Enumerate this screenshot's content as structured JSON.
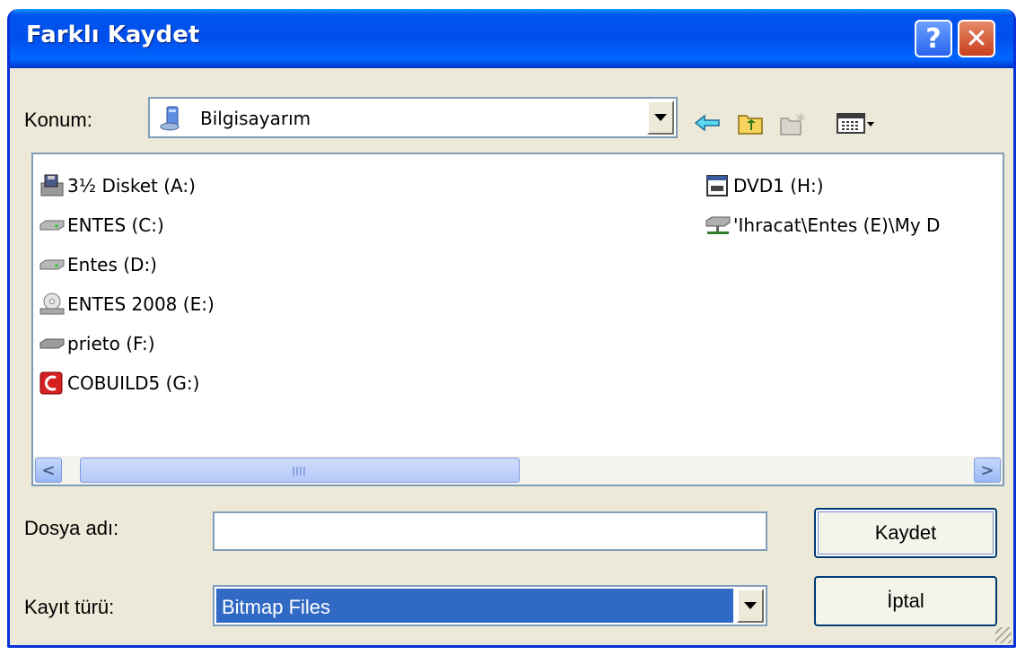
{
  "window": {
    "title": "Farklı Kaydet"
  },
  "title_buttons": {
    "help": "?",
    "close": "✕"
  },
  "location": {
    "label": "Konum:",
    "value": "Bilgisayarım"
  },
  "toolbar": {
    "back_icon": "back-arrow-icon",
    "up_icon": "up-folder-icon",
    "new_folder_icon": "new-folder-icon",
    "views_icon": "views-menu-icon"
  },
  "files": [
    {
      "label": "3½ Disket (A:)",
      "icon": "floppy-drive-icon"
    },
    {
      "label": "ENTES (C:)",
      "icon": "hard-drive-icon"
    },
    {
      "label": "Entes (D:)",
      "icon": "hard-drive-icon"
    },
    {
      "label": "ENTES 2008 (E:)",
      "icon": "cd-drive-icon"
    },
    {
      "label": "prieto (F:)",
      "icon": "removable-drive-icon"
    },
    {
      "label": "COBUILD5 (G:)",
      "icon": "cobuild-icon"
    },
    {
      "label": "DVD1 (H:)",
      "icon": "dvd-drive-icon"
    },
    {
      "label": "'Ihracat\\Entes (E)\\My D",
      "icon": "network-drive-icon"
    }
  ],
  "filename": {
    "label": "Dosya adı:",
    "value": ""
  },
  "filetype": {
    "label": "Kayıt türü:",
    "value": "Bitmap Files"
  },
  "buttons": {
    "save": "Kaydet",
    "cancel": "İptal"
  },
  "scrollbar": {
    "left": "<",
    "right": ">"
  },
  "colors": {
    "titlebar": "#0054e3",
    "face": "#ece9d8",
    "selection": "#316ac5"
  }
}
